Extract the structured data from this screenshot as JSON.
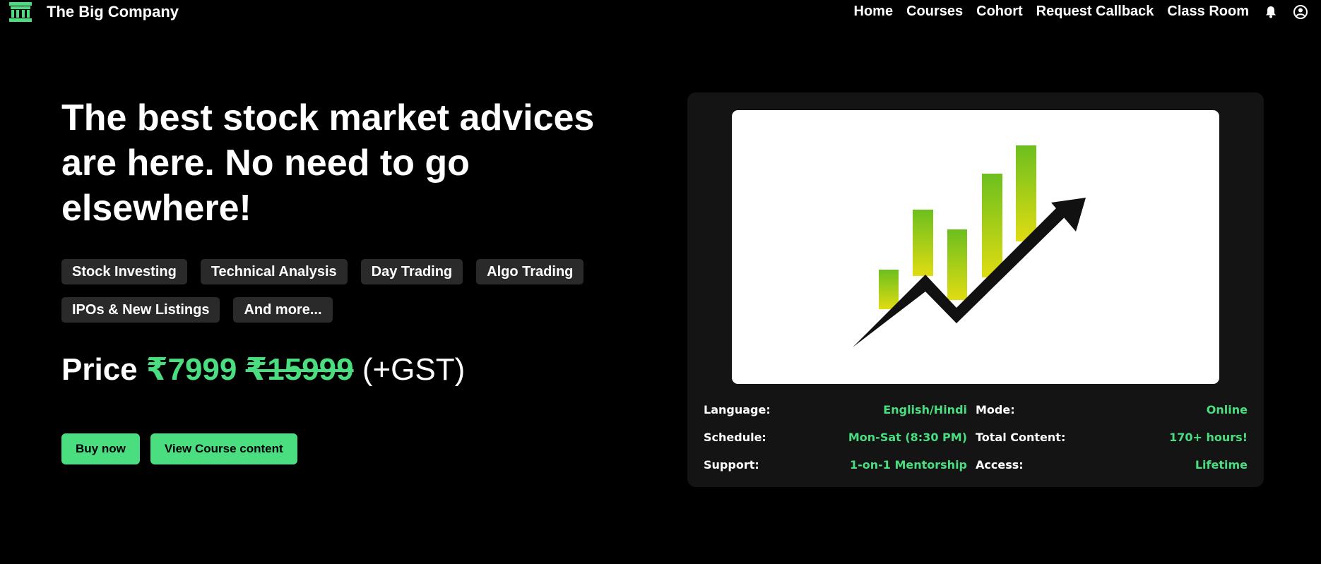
{
  "brand": {
    "name": "The Big Company",
    "icon": "bank-building-icon",
    "color": "#4ade80"
  },
  "nav": {
    "links": [
      "Home",
      "Courses",
      "Cohort",
      "Request Callback",
      "Class Room"
    ],
    "icons": [
      "bell-icon",
      "user-circle-icon"
    ]
  },
  "hero": {
    "headline": "The best stock market advices are here. No need to go elsewhere!",
    "tags": [
      "Stock Investing",
      "Technical Analysis",
      "Day Trading",
      "Algo Trading",
      "IPOs & New Listings",
      "And more..."
    ],
    "price": {
      "label": "Price",
      "current": "₹7999",
      "original": "₹15999",
      "suffix": "(+GST)"
    },
    "buttons": {
      "buy": "Buy now",
      "view": "View Course content"
    }
  },
  "card": {
    "image": "growth-chart-illustration",
    "details": [
      {
        "label": "Language:",
        "value": "English/Hindi"
      },
      {
        "label": "Mode:",
        "value": "Online"
      },
      {
        "label": "Schedule:",
        "value": "Mon-Sat (8:30 PM)"
      },
      {
        "label": "Total Content:",
        "value": "170+ hours!"
      },
      {
        "label": "Support:",
        "value": "1-on-1 Mentorship"
      },
      {
        "label": "Access:",
        "value": "Lifetime"
      }
    ]
  },
  "colors": {
    "accent": "#4ade80",
    "background": "#000000",
    "card": "#141414",
    "tag": "#2a2a2a"
  }
}
